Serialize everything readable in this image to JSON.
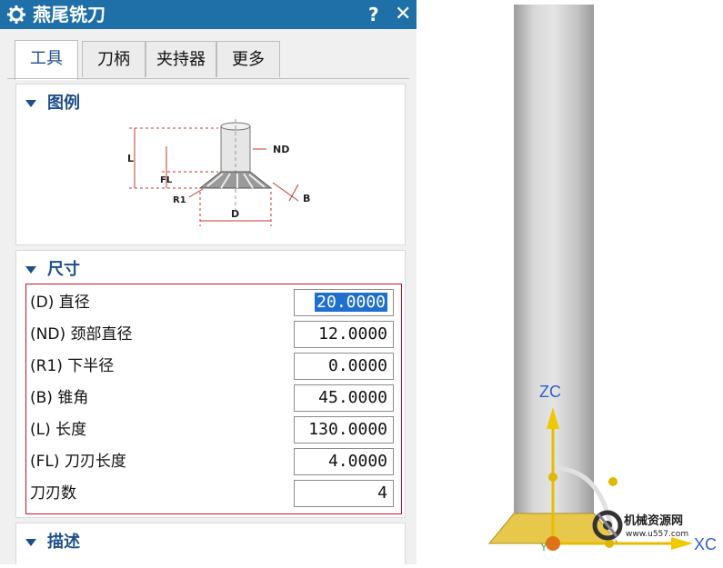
{
  "dialog": {
    "title": "燕尾铣刀",
    "help_label": "?",
    "close_label": "✕",
    "tabs": [
      {
        "label": "工具",
        "active": true
      },
      {
        "label": "刀柄",
        "active": false
      },
      {
        "label": "夹持器",
        "active": false
      },
      {
        "label": "更多",
        "active": false
      }
    ]
  },
  "legend_section": {
    "title": "图例",
    "diagram_labels": {
      "L": "L",
      "ND": "ND",
      "FL": "FL",
      "R1": "R1",
      "B": "B",
      "D": "D"
    }
  },
  "dimensions_section": {
    "title": "尺寸",
    "rows": [
      {
        "label": "(D) 直径",
        "value": "20.0000",
        "selected": true
      },
      {
        "label": "(ND) 颈部直径",
        "value": "12.0000"
      },
      {
        "label": "(R1) 下半径",
        "value": "0.0000"
      },
      {
        "label": "(B) 锥角",
        "value": "45.0000"
      },
      {
        "label": "(L) 长度",
        "value": "130.0000"
      },
      {
        "label": "(FL) 刀刃长度",
        "value": "4.0000"
      },
      {
        "label": "刀刃数",
        "value": "4"
      }
    ]
  },
  "description_section": {
    "title": "描述"
  },
  "viewport": {
    "axis_z_label": "ZC",
    "axis_x_label": "XC",
    "axis_y_label": "Y",
    "watermark_title": "机械资源网",
    "watermark_url": "www.u557.com",
    "colors": {
      "axis_z": "#2f5fd0",
      "axis_x": "#e0b000",
      "axis_y": "#3aa83a",
      "title_bar": "#1f6fa8",
      "highlight_box": "#c8102e"
    }
  }
}
